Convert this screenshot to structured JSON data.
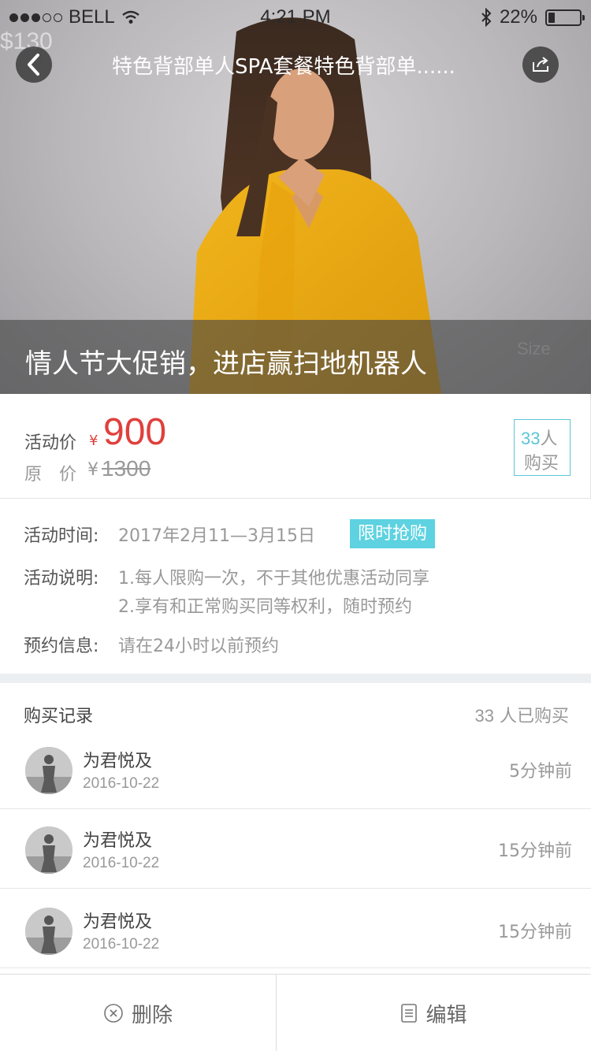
{
  "status_bar": {
    "carrier": "BELL",
    "time": "4:21 PM",
    "battery": "22%",
    "battery_level": 0.22
  },
  "nav": {
    "title": "特色背部单人SPA套餐特色背部单......"
  },
  "hero": {
    "banner_text": "情人节大促销，进店赢扫地机器人"
  },
  "price": {
    "activity_label": "活动价",
    "currency": "¥",
    "activity_price": "900",
    "original_label": "原　价",
    "original_price": "1300",
    "buyers_count": "33",
    "buyers_unit": "人",
    "buyers_text": "购买"
  },
  "info": {
    "time_label": "活动时间:",
    "time_value": "2017年2月11—3月15日",
    "promo_tag": "限时抢购",
    "desc_label": "活动说明:",
    "desc_lines": [
      "1.每人限购一次，不于其他优惠活动同享",
      "2.享有和正常购买同等权利，随时预约"
    ],
    "booking_label": "预约信息:",
    "booking_value": "请在24小时以前预约"
  },
  "records": {
    "title": "购买记录",
    "count": "33",
    "count_text": "人已购买",
    "items": [
      {
        "name": "为君悦及",
        "date": "2016-10-22",
        "ago": "5分钟前"
      },
      {
        "name": "为君悦及",
        "date": "2016-10-22",
        "ago": "15分钟前"
      },
      {
        "name": "为君悦及",
        "date": "2016-10-22",
        "ago": "15分钟前"
      }
    ]
  },
  "footer": {
    "delete_label": "删除",
    "edit_label": "编辑"
  },
  "icons": [
    "signal-dots-icon",
    "wifi-icon",
    "bluetooth-icon",
    "battery-icon",
    "back-arrow-icon",
    "share-icon",
    "delete-circle-icon",
    "edit-doc-icon"
  ],
  "colors": {
    "price_red": "#e0403c",
    "accent_cyan": "#5bc6d6",
    "tag_bg": "#5ed2e0"
  }
}
